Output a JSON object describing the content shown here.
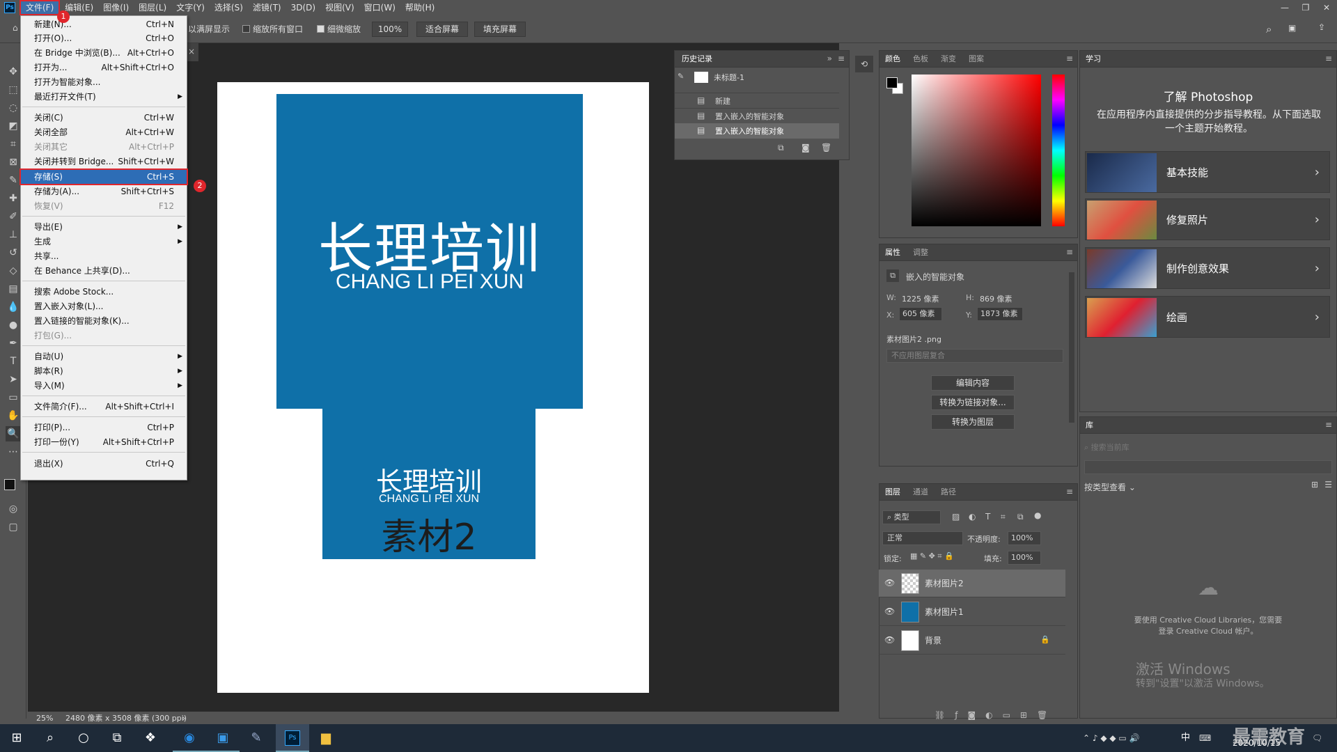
{
  "app": {
    "logo": "Ps"
  },
  "menubar": {
    "items": [
      "文件(F)",
      "编辑(E)",
      "图像(I)",
      "图层(L)",
      "文字(Y)",
      "选择(S)",
      "滤镜(T)",
      "3D(D)",
      "视图(V)",
      "窗口(W)",
      "帮助(H)"
    ]
  },
  "options": {
    "fullscreen_label": "以满屏显示",
    "scroll_all_label": "缩放所有窗口",
    "scrubby_label": "细微缩放",
    "zoom_value": "100%",
    "fit_screen_label": "适合屏幕",
    "fill_screen_label": "填充屏幕"
  },
  "file_menu": {
    "items": [
      {
        "label": "新建(N)...",
        "shortcut": "Ctrl+N"
      },
      {
        "label": "打开(O)...",
        "shortcut": "Ctrl+O"
      },
      {
        "label": "在 Bridge 中浏览(B)...",
        "shortcut": "Alt+Ctrl+O"
      },
      {
        "label": "打开为...",
        "shortcut": "Alt+Shift+Ctrl+O"
      },
      {
        "label": "打开为智能对象...",
        "shortcut": ""
      },
      {
        "label": "最近打开文件(T)",
        "shortcut": ""
      },
      {
        "label": "关闭(C)",
        "shortcut": "Ctrl+W"
      },
      {
        "label": "关闭全部",
        "shortcut": "Alt+Ctrl+W"
      },
      {
        "label": "关闭其它",
        "shortcut": "Alt+Ctrl+P"
      },
      {
        "label": "关闭并转到 Bridge...",
        "shortcut": "Shift+Ctrl+W"
      },
      {
        "label": "存储(S)",
        "shortcut": "Ctrl+S"
      },
      {
        "label": "存储为(A)...",
        "shortcut": "Shift+Ctrl+S"
      },
      {
        "label": "恢复(V)",
        "shortcut": "F12"
      },
      {
        "label": "导出(E)",
        "shortcut": ""
      },
      {
        "label": "生成",
        "shortcut": ""
      },
      {
        "label": "共享...",
        "shortcut": ""
      },
      {
        "label": "在 Behance 上共享(D)...",
        "shortcut": ""
      },
      {
        "label": "搜索 Adobe Stock...",
        "shortcut": ""
      },
      {
        "label": "置入嵌入对象(L)...",
        "shortcut": ""
      },
      {
        "label": "置入链接的智能对象(K)...",
        "shortcut": ""
      },
      {
        "label": "打包(G)...",
        "shortcut": ""
      },
      {
        "label": "自动(U)",
        "shortcut": ""
      },
      {
        "label": "脚本(R)",
        "shortcut": ""
      },
      {
        "label": "导入(M)",
        "shortcut": ""
      },
      {
        "label": "文件简介(F)...",
        "shortcut": "Alt+Shift+Ctrl+I"
      },
      {
        "label": "打印(P)...",
        "shortcut": "Ctrl+P"
      },
      {
        "label": "打印一份(Y)",
        "shortcut": "Alt+Shift+Ctrl+P"
      },
      {
        "label": "退出(X)",
        "shortcut": "Ctrl+Q"
      }
    ],
    "step1": "1",
    "step2": "2"
  },
  "canvas": {
    "image1_title": "长理培训",
    "image1_subtitle": "CHANG LI PEI XUN",
    "image2_title": "长理培训",
    "image2_subtitle": "CHANG LI PEI XUN",
    "image2_caption": "素材2",
    "bg_color": "#0f70a8"
  },
  "status": {
    "zoom": "25%",
    "doc_info": "2480 像素 x 3508 像素 (300 ppi)"
  },
  "history": {
    "tab": "历史记录",
    "snapshot": "未标题-1",
    "items": [
      "新建",
      "置入嵌入的智能对象",
      "置入嵌入的智能对象"
    ]
  },
  "color_panel": {
    "tabs": [
      "颜色",
      "色板",
      "渐变",
      "图案"
    ]
  },
  "properties": {
    "tabs": [
      "属性",
      "调整"
    ],
    "type": "嵌入的智能对象",
    "w_label": "W:",
    "w_value": "1225 像素",
    "h_label": "H:",
    "h_value": "869 像素",
    "x_label": "X:",
    "x_value": "605 像素",
    "y_label": "Y:",
    "y_value": "1873 像素",
    "file": "素材图片2 .png",
    "comp_placeholder": "不应用图层复合",
    "btn_edit": "编辑内容",
    "btn_link": "转换为链接对象...",
    "btn_layers": "转换为图层"
  },
  "layers": {
    "tabs": [
      "图层",
      "通道",
      "路径"
    ],
    "filter": "类型",
    "blend": "正常",
    "opacity_label": "不透明度:",
    "opacity_value": "100%",
    "lock_label": "锁定:",
    "fill_label": "填充:",
    "fill_value": "100%",
    "items": [
      "素材图片2",
      "素材图片1",
      "背景"
    ]
  },
  "learn": {
    "tab": "学习",
    "title": "了解 Photoshop",
    "desc": "在应用程序内直接提供的分步指导教程。从下面选取一个主题开始教程。",
    "items": [
      "基本技能",
      "修复照片",
      "制作创意效果",
      "绘画"
    ]
  },
  "libraries": {
    "tab": "库",
    "search_placeholder": "搜索当前库",
    "view_label": "按类型查看",
    "cc_message": "要使用 Creative Cloud Libraries，您需要登录 Creative Cloud 帐户。"
  },
  "watermark": {
    "line1": "激活 Windows",
    "line2": "转到\"设置\"以激活 Windows。",
    "brand": "最需教育"
  },
  "taskbar": {
    "ime": "中",
    "date": "2020/10/15"
  }
}
